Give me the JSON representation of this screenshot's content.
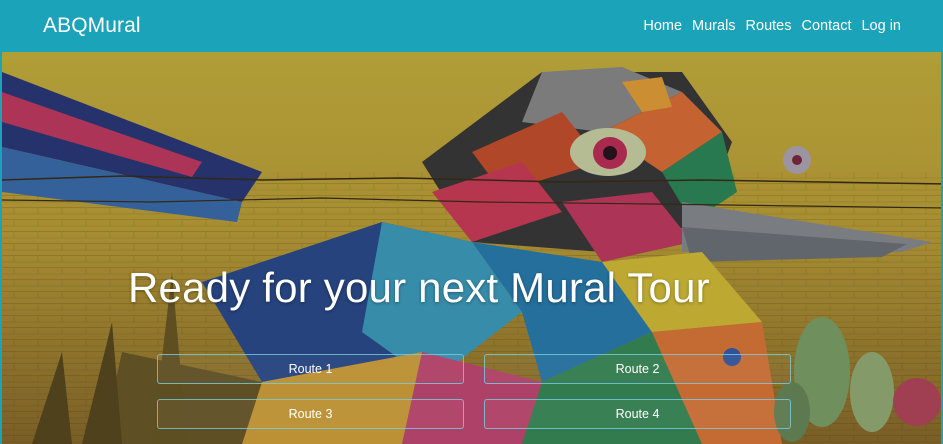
{
  "nav": {
    "brand": "ABQMural",
    "links": [
      "Home",
      "Murals",
      "Routes",
      "Contact",
      "Log in"
    ]
  },
  "hero": {
    "title": "Ready for your next Mural Tour",
    "image": "bird-mural-photo",
    "routes": [
      "Route 1",
      "Route 2",
      "Route 3",
      "Route 4"
    ]
  },
  "colors": {
    "navbar": "#1ba3b9",
    "text": "#ffffff",
    "button_border": "#78cde1"
  }
}
